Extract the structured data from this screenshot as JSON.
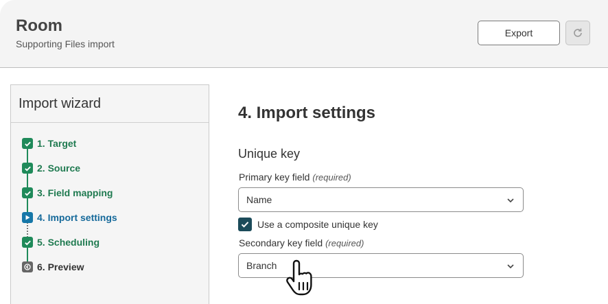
{
  "header": {
    "title": "Room",
    "subtitle": "Supporting Files import",
    "export_label": "Export",
    "refresh_icon": "refresh-icon"
  },
  "wizard": {
    "title": "Import wizard",
    "steps": [
      {
        "label": "1. Target",
        "state": "done"
      },
      {
        "label": "2. Source",
        "state": "done"
      },
      {
        "label": "3. Field mapping",
        "state": "done"
      },
      {
        "label": "4. Import settings",
        "state": "current"
      },
      {
        "label": "5. Scheduling",
        "state": "done"
      },
      {
        "label": "6. Preview",
        "state": "pending"
      }
    ]
  },
  "main": {
    "heading": "4. Import settings",
    "section": "Unique key",
    "primary": {
      "label": "Primary key field",
      "required": "(required)",
      "value": "Name"
    },
    "composite": {
      "label": "Use a composite unique key",
      "checked": true
    },
    "secondary": {
      "label": "Secondary key field",
      "required": "(required)",
      "value": "Branch"
    }
  },
  "colors": {
    "done": "#1f8a5a",
    "current": "#1677a8",
    "pending": "#666666",
    "checkbox": "#1b4b5a"
  }
}
